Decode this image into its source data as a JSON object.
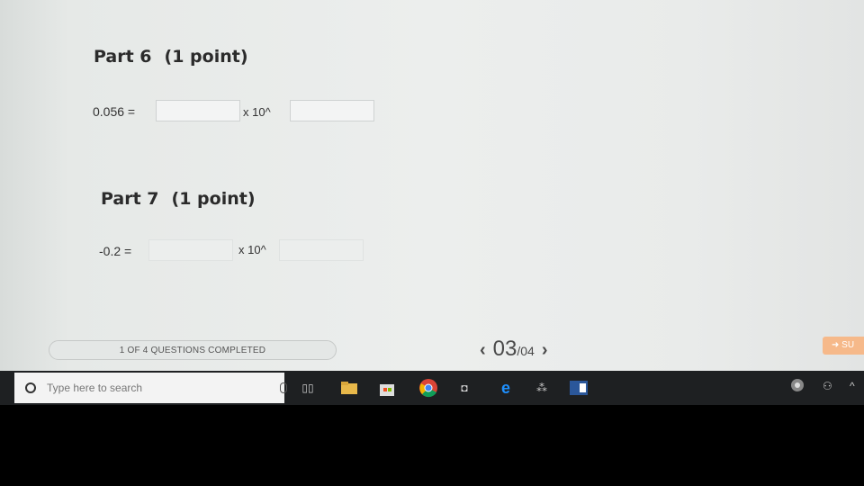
{
  "questions": [
    {
      "title": "Part 6",
      "points": "(1 point)",
      "equation": "0.056 =",
      "multiplier": "x 10^",
      "mantissa_value": "",
      "exponent_value": ""
    },
    {
      "title": "Part 7",
      "points": "(1 point)",
      "equation": "-0.2 =",
      "multiplier": "x 10^",
      "mantissa_value": "",
      "exponent_value": ""
    }
  ],
  "footer": {
    "progress_text": "1 OF 4 QUESTIONS COMPLETED",
    "progress_fraction": 0.25,
    "page_current": "03",
    "page_total": "/04",
    "prev_icon": "chevron-left-icon",
    "next_icon": "chevron-right-icon",
    "submit_label": "SU"
  },
  "taskbar": {
    "search_placeholder": "Type here to search",
    "icons": [
      "cortana-circle-icon",
      "microphone-icon",
      "task-view-icon",
      "file-explorer-icon",
      "store-icon",
      "chrome-icon",
      "media-player-icon",
      "edge-icon",
      "app-icon",
      "word-icon"
    ],
    "tray_icons": [
      "chrome-icon",
      "people-icon",
      "chevron-up-icon"
    ]
  },
  "colors": {
    "accent_submit": "#f6b98a",
    "taskbar": "#1e2022"
  }
}
